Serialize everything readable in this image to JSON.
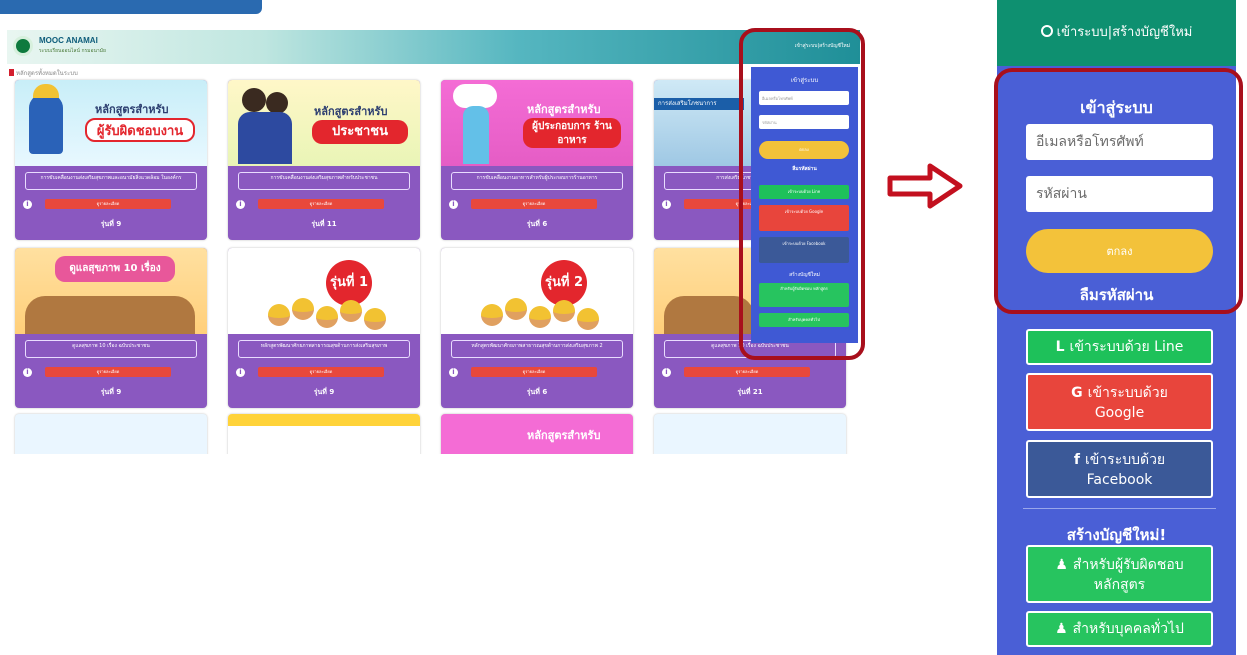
{
  "mini": {
    "brand": "MOOC ANAMAI",
    "brand_sub": "ระบบเรียนออนไลน์ กรมอนามัย",
    "breadcrumb": "หลักสูตรทั้งหมดในระบบ",
    "header_login": "เข้าสู่ระบบ|สร้างบัญชีใหม่",
    "cards": [
      {
        "img_text": "หลักสูตรสำหรับ",
        "img_ribbon": "ผู้รับผิดชอบงาน",
        "title": "การขับเคลื่อนงานส่งเสริมสุขภาพและอนามัยสิ่งแวดล้อม ในองค์กร",
        "btn": "ดูรายละเอียด",
        "num": "รุ่นที่ 9"
      },
      {
        "img_text": "หลักสูตรสำหรับ",
        "img_ribbon": "ประชาชน",
        "title": "การขับเคลื่อนงานส่งเสริมสุขภาพสำหรับประชาชน",
        "btn": "ดูรายละเอียด",
        "num": "รุ่นที่ 11"
      },
      {
        "img_text": "หลักสูตรสำหรับ",
        "img_ribbon": "ผู้ประกอบการ ร้านอาหาร",
        "title": "การขับเคลื่อนงานอาหารสำหรับผู้ประกอบการร้านอาหาร",
        "btn": "ดูรายละเอียด",
        "num": "รุ่นที่ 6"
      },
      {
        "img_text": "การส่งเสริมโภชนาการ",
        "img_ribbon": "",
        "title": "การส่งเสริมโภชนาการ Project",
        "btn": "ดูรายละเอียด",
        "num": ""
      },
      {
        "img_text": "",
        "img_ribbon": "ดูแลสุขภาพ 10 เรื่อง",
        "title": "ดูแลสุขภาพ 10 เรื่อง ฉบับประชาชน",
        "btn": "ดูรายละเอียด",
        "num": "รุ่นที่ 9"
      },
      {
        "img_text": "",
        "img_ribbon": "รุ่นที่ 1",
        "title": "หลักสูตรพัฒนาศักยภาพสาธารณสุขด้านการส่งเสริมสุขภาพ",
        "btn": "ดูรายละเอียด",
        "num": "รุ่นที่ 9"
      },
      {
        "img_text": "",
        "img_ribbon": "รุ่นที่ 2",
        "title": "หลักสูตรพัฒนาศักยภาพสาธารณสุขด้านการส่งเสริมสุขภาพ 2",
        "btn": "ดูรายละเอียด",
        "num": "รุ่นที่ 6"
      },
      {
        "img_text": "",
        "img_ribbon": "",
        "title": "ดูแลสุขภาพ 10 เรื่อง ฉบับประชาชน",
        "btn": "ดูรายละเอียด",
        "num": "รุ่นที่ 21"
      }
    ],
    "panel": {
      "title": "เข้าสู่ระบบ",
      "email_ph": "อีเมลหรือโทรศัพท์",
      "pass_ph": "รหัสผ่าน",
      "login": "ตกลง",
      "forgot": "ลืมรหัสผ่าน",
      "line": "เข้าระบบด้วย Line",
      "google": "เข้าระบบด้วย Google",
      "facebook": "เข้าระบบด้วย Facebook",
      "create": "สร้างบัญชีใหม่",
      "creator": "สำหรับผู้รับผิดชอบ หลักสูตร",
      "general": "สำหรับบุคคลทั่วไป"
    }
  },
  "right": {
    "header": "เข้าระบบ|สร้างบัญชีใหม่",
    "title": "เข้าสู่ระบบ",
    "email_placeholder": "อีเมลหรือโทรศัพท์",
    "password_placeholder": "รหัสผ่าน",
    "login": "ตกลง",
    "forgot": "ลืมรหัสผ่าน",
    "line_icon": "L",
    "line": "เข้าระบบด้วย Line",
    "google_icon": "G",
    "google_1": "เข้าระบบด้วย",
    "google_2": "Google",
    "fb_icon": "f",
    "fb_1": "เข้าระบบด้วย",
    "fb_2": "Facebook",
    "create": "สร้างบัญชีใหม่!",
    "creator_1": "สำหรับผู้รับผิดชอบ",
    "creator_2": "หลักสูตร",
    "general": "สำหรับบุคคลทั่วไป"
  },
  "colors": {
    "panel_blue": "#4a5fd6",
    "header_green": "#0e9070",
    "yellow": "#f3c23a",
    "line_green": "#1ec15a",
    "google_red": "#e8453c",
    "fb_blue": "#3b5998",
    "create_green": "#27c45f",
    "highlight_red": "#a80f1c",
    "card_purple": "#8a58c0"
  }
}
